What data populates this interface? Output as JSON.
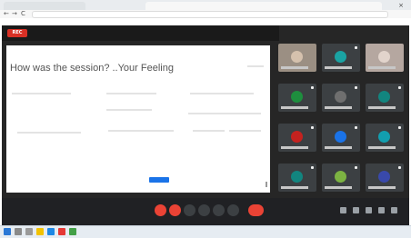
{
  "browser": {
    "tab_close": "×",
    "nav_back": "←",
    "nav_forward": "→",
    "nav_reload": "C"
  },
  "meeting": {
    "rec_label": "REC",
    "title": "",
    "time_label": ""
  },
  "slide": {
    "heading": "How was the session? ..Your Feeling"
  },
  "colors": {
    "app_bg": "#262626",
    "record_red": "#d93025",
    "end_call_red": "#ea4335",
    "primary_blue": "#1a73e8"
  }
}
